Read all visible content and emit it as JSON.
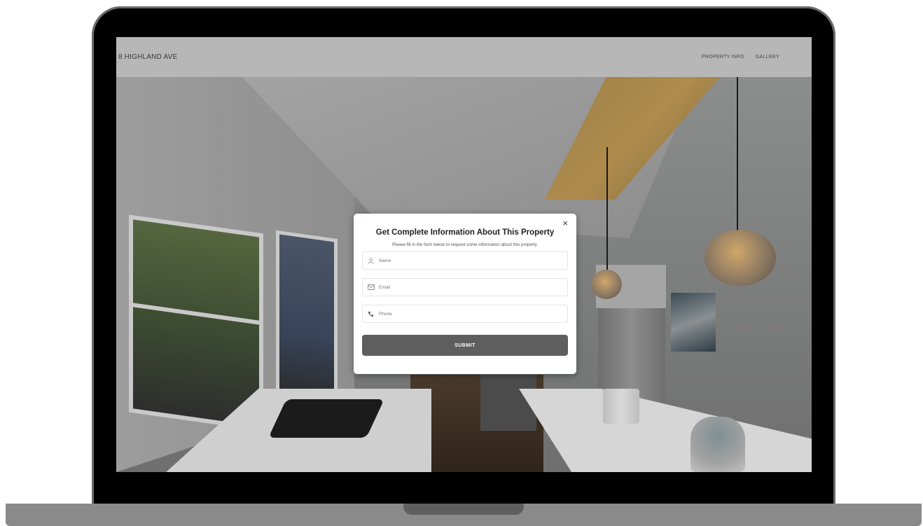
{
  "header": {
    "site_title": "8 HIGHLAND AVE",
    "nav": [
      "PROPERTY INFO",
      "GALLERY"
    ]
  },
  "modal": {
    "close_glyph": "×",
    "title": "Get Complete Information About This Property",
    "description": "Please fill in the form below to request some information about this property.",
    "fields": [
      {
        "placeholder": "Name",
        "icon": "user-icon"
      },
      {
        "placeholder": "Email",
        "icon": "envelope-icon"
      },
      {
        "placeholder": "Phone",
        "icon": "phone-icon"
      }
    ],
    "submit_label": "SUBMIT"
  },
  "colors": {
    "header_bg": "#b7b7b7",
    "submit_bg": "#5e5e5e"
  }
}
